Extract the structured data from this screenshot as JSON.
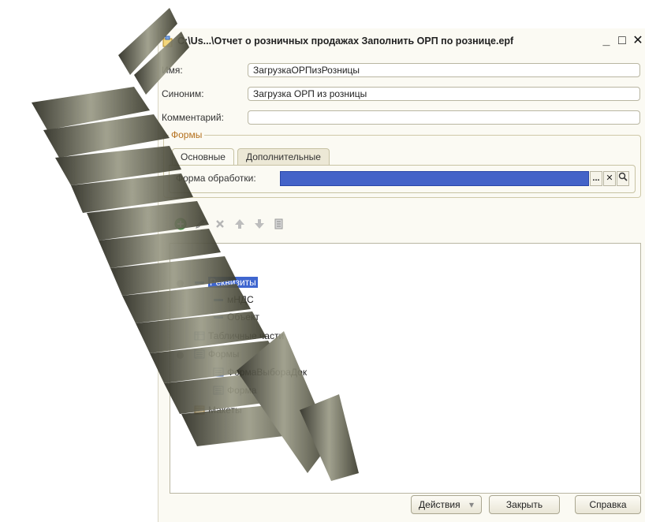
{
  "window": {
    "title": "C:\\Us...\\Отчет о розничных продажах Заполнить ОРП по рознице.epf",
    "minimize": "_",
    "maximize": "□",
    "close": "✕"
  },
  "fields": {
    "name_label": "Имя:",
    "name_value": "ЗагрузкаОРПизРозницы",
    "synonym_label": "Синоним:",
    "synonym_value": "Загрузка ОРП из розницы",
    "comment_label": "Комментарий:",
    "comment_value": ""
  },
  "forms_group": {
    "legend": "Формы",
    "tabs": [
      {
        "label": "Основные",
        "active": true
      },
      {
        "label": "Дополнительные",
        "active": false
      }
    ],
    "form_label": "Форма обработки:",
    "form_value": "",
    "select_btn": "...",
    "clear_btn": "✕",
    "open_btn": "Q"
  },
  "toolbar": {
    "icons": [
      "add-icon",
      "edit-icon",
      "delete-icon",
      "move-up-icon",
      "move-down-icon",
      "sort-icon"
    ]
  },
  "tree": {
    "items": [
      {
        "label": "Реквизиты",
        "selected": true
      },
      {
        "label": "мНДС"
      },
      {
        "label": "Объект"
      },
      {
        "label": "Табличные части"
      },
      {
        "label": "Формы"
      },
      {
        "label": "ФормаВыбораДок"
      },
      {
        "label": "Форма"
      },
      {
        "label": "Макеты"
      }
    ]
  },
  "buttons": {
    "actions": "Действия",
    "actions_arrow": "▾",
    "close": "Закрыть",
    "help": "Справка"
  },
  "colors": {
    "selection": "#3f66cf",
    "group_legend": "#b4701d",
    "window_bg": "#fbfaf3"
  }
}
